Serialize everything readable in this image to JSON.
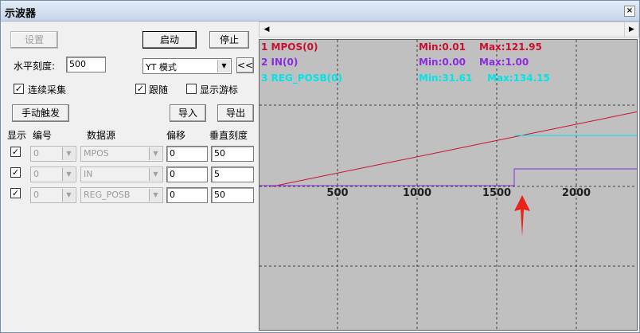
{
  "window": {
    "title": "示波器",
    "close_label": "×"
  },
  "controls": {
    "settings_label": "设置",
    "start_label": "启动",
    "stop_label": "停止",
    "hscale_label": "水平刻度:",
    "hscale_value": "500",
    "mode_value": "YT 模式",
    "collapse_label": "<<",
    "continuous_label": "连续采集",
    "continuous_checked": true,
    "follow_label": "跟随",
    "follow_checked": true,
    "cursor_label": "显示游标",
    "cursor_checked": false,
    "manual_trigger_label": "手动触发",
    "import_label": "导入",
    "export_label": "导出"
  },
  "channel_table": {
    "headers": [
      "显示",
      "编号",
      "数据源",
      "偏移",
      "垂直刻度"
    ],
    "rows": [
      {
        "show": true,
        "number": "0",
        "source": "MPOS",
        "offset": "0",
        "scale": "50"
      },
      {
        "show": true,
        "number": "0",
        "source": "IN",
        "offset": "0",
        "scale": "5"
      },
      {
        "show": true,
        "number": "0",
        "source": "REG_POSB",
        "offset": "0",
        "scale": "50"
      }
    ]
  },
  "scope": {
    "legend": [
      {
        "name": "1 MPOS(0)",
        "min": "Min:0.01",
        "max": "Max:121.95",
        "color": "#c8102e"
      },
      {
        "name": "2 IN(0)",
        "min": "Min:0.00",
        "max": "Max:1.00",
        "color": "#8a2be2"
      },
      {
        "name": "3 REG_POSB(0)",
        "min": "Min:31.61",
        "max": "Max:134.15",
        "color": "#00e5e5"
      }
    ],
    "x_ticks": [
      "500",
      "1000",
      "1500",
      "2000"
    ],
    "background": "#c0c0c0",
    "grid_color": "#404040",
    "annotation": "red-arrow pointing at x≈1560"
  },
  "chart_data": {
    "type": "line",
    "x_ticks": [
      500,
      1000,
      1500,
      2000
    ],
    "xlim": [
      0,
      2380
    ],
    "series": [
      {
        "name": "1 MPOS(0)",
        "color": "#c8102e",
        "x": [
          80,
          2380
        ],
        "y": [
          0,
          1
        ]
      },
      {
        "name": "2 IN(0)",
        "color": "#8a2be2",
        "x": [
          0,
          1600,
          1600,
          2380
        ],
        "y": [
          0,
          0,
          1,
          1
        ]
      },
      {
        "name": "3 REG_POSB(0)",
        "color": "#00e5e5",
        "x": [
          1600,
          2380
        ],
        "y": [
          1,
          1
        ]
      }
    ]
  }
}
